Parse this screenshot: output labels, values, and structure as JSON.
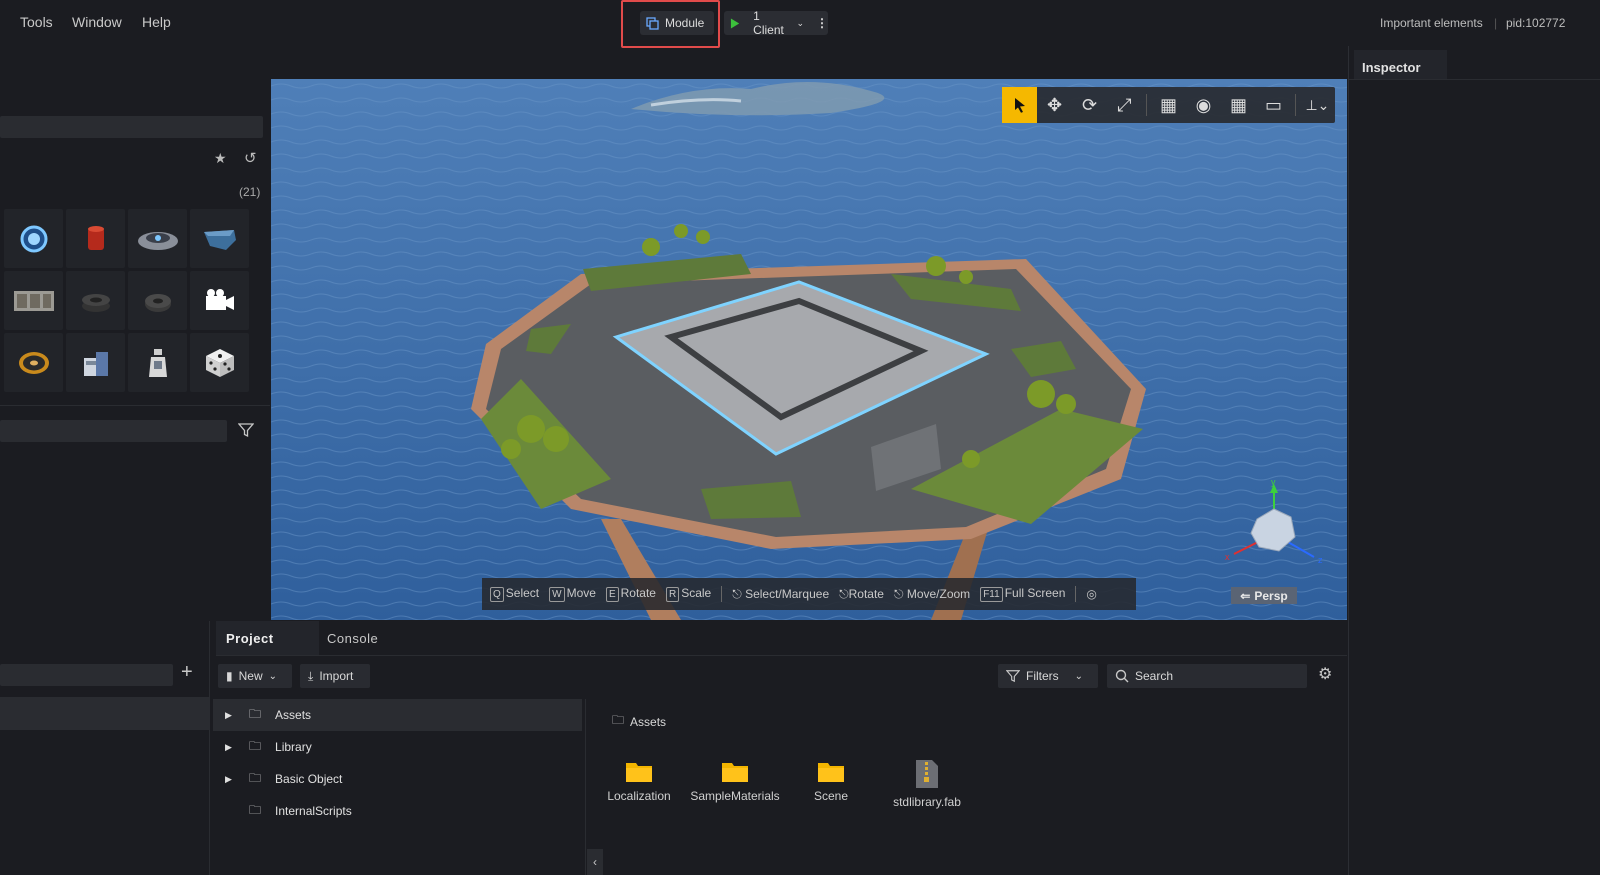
{
  "menu": {
    "tools": "Tools",
    "window": "Window",
    "help": "Help"
  },
  "toolbar": {
    "module_label": "Module",
    "client_label": "1 Client",
    "important": "Important elements",
    "pid": "pid:102772"
  },
  "left_panel": {
    "count": "(21)"
  },
  "viewport": {
    "hints": [
      {
        "key": "Q",
        "label": "Select"
      },
      {
        "key": "W",
        "label": "Move"
      },
      {
        "key": "E",
        "label": "Rotate"
      },
      {
        "key": "R",
        "label": "Scale"
      }
    ],
    "mouse_hints": [
      "Select/Marquee",
      "Rotate",
      "Move/Zoom"
    ],
    "fullscreen": {
      "key": "F11",
      "label": "Full Screen"
    },
    "persp": "Persp",
    "axes": {
      "x": "x",
      "y": "y",
      "z": "z"
    }
  },
  "inspector": {
    "title": "Inspector"
  },
  "bottom": {
    "tabs": [
      "Project",
      "Console"
    ],
    "new_label": "New",
    "import_label": "Import",
    "filters_label": "Filters",
    "search_placeholder": "Search",
    "tree": [
      "Assets",
      "Library",
      "Basic Object",
      "InternalScripts"
    ],
    "breadcrumb": "Assets",
    "files": [
      {
        "name": "Localization",
        "type": "folder"
      },
      {
        "name": "SampleMaterials",
        "type": "folder"
      },
      {
        "name": "Scene",
        "type": "folder"
      },
      {
        "name": "stdlibrary.fab",
        "type": "archive"
      }
    ]
  },
  "colors": {
    "accent": "#f5b800",
    "highlight": "#e14b4b",
    "play": "#3cc03c",
    "folder": "#f3b500"
  }
}
